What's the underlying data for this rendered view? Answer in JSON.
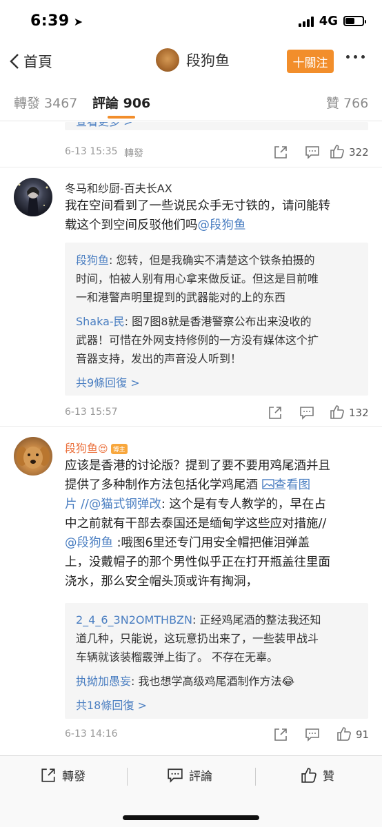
{
  "status_bar": {
    "time": "6:39",
    "network": "4G"
  },
  "nav": {
    "back_label": "首頁",
    "title": "段狗鱼",
    "follow_label": "十關注"
  },
  "tabs": [
    {
      "label": "轉發 3467"
    },
    {
      "label": "評論 906"
    },
    {
      "label": "贊 766"
    }
  ],
  "comments": [
    {
      "partial_text": "查看更多 >",
      "time": "6-13 15:35",
      "repost_label": "轉發",
      "like_count": "322"
    },
    {
      "user": "冬马和纱厨-百夫长AX",
      "text_a": "我在空间看到了一些说民众手无寸铁的，请问能转",
      "text_b": "载这个到空间反驳他们吗",
      "mention": "@段狗鱼",
      "replies": [
        {
          "name": "段狗鱼",
          "l1": ": 您转，但是我确实不清楚这个铁条拍摄的",
          "l2": "时间，怕被人别有用心拿来做反证。但这是目前唯",
          "l3": "一和港警声明里提到的武器能对的上的东西"
        },
        {
          "name": "Shaka-民",
          "l1": ": 图7图8就是香港警察公布出来没收的",
          "l2": "武器！可惜在外网支持修例的一方没有媒体这个扩",
          "l3": "音器支持，发出的声音没人听到！"
        }
      ],
      "more_replies": "共9條回復 >",
      "time": "6-13 15:57",
      "like_count": "132"
    },
    {
      "user": "段狗鱼",
      "badge": "博主",
      "l1": "应该是香港的讨论版？提到了要不要用鸡尾酒并且",
      "l2": "提供了多种制作方法包括化学鸡尾酒",
      "view_image": "查看图",
      "l3_a": "片",
      "l3_mention": "//@猫式钢弹改",
      "l3_b": ": 这个是有专人教学的，早在占",
      "l4": "中之前就有干部去泰国还是缅甸学这些应对措施//",
      "l5_mention": "@段狗鱼",
      "l5_b": " :哦图6里还专门用安全帽把催泪弹盖",
      "l6": "上，没戴帽子的那个男性似乎正在打开瓶盖往里面",
      "l7": "浇水，那么安全帽头顶或许有掏洞，",
      "replies": [
        {
          "name": "2_4_6_3N2OMTHBZN",
          "l1": ": 正经鸡尾酒的整法我还知",
          "l2": "道几种，只能说，这玩意扔出来了，一些装甲战斗",
          "l3": "车辆就该装榴霰弹上街了。 不存在无辜。"
        },
        {
          "name": "执拗加愚妄",
          "l1": ": 我也想学高级鸡尾酒制作方法😂"
        }
      ],
      "more_replies": "共18條回復 >",
      "time": "6-13 14:16",
      "like_count": "91"
    }
  ],
  "bottom_bar": {
    "repost": "轉發",
    "comment": "評論",
    "like": "贊"
  },
  "colors": {
    "accent": "#f28e2b",
    "link": "#4a7ec1",
    "author": "#eb7340"
  }
}
